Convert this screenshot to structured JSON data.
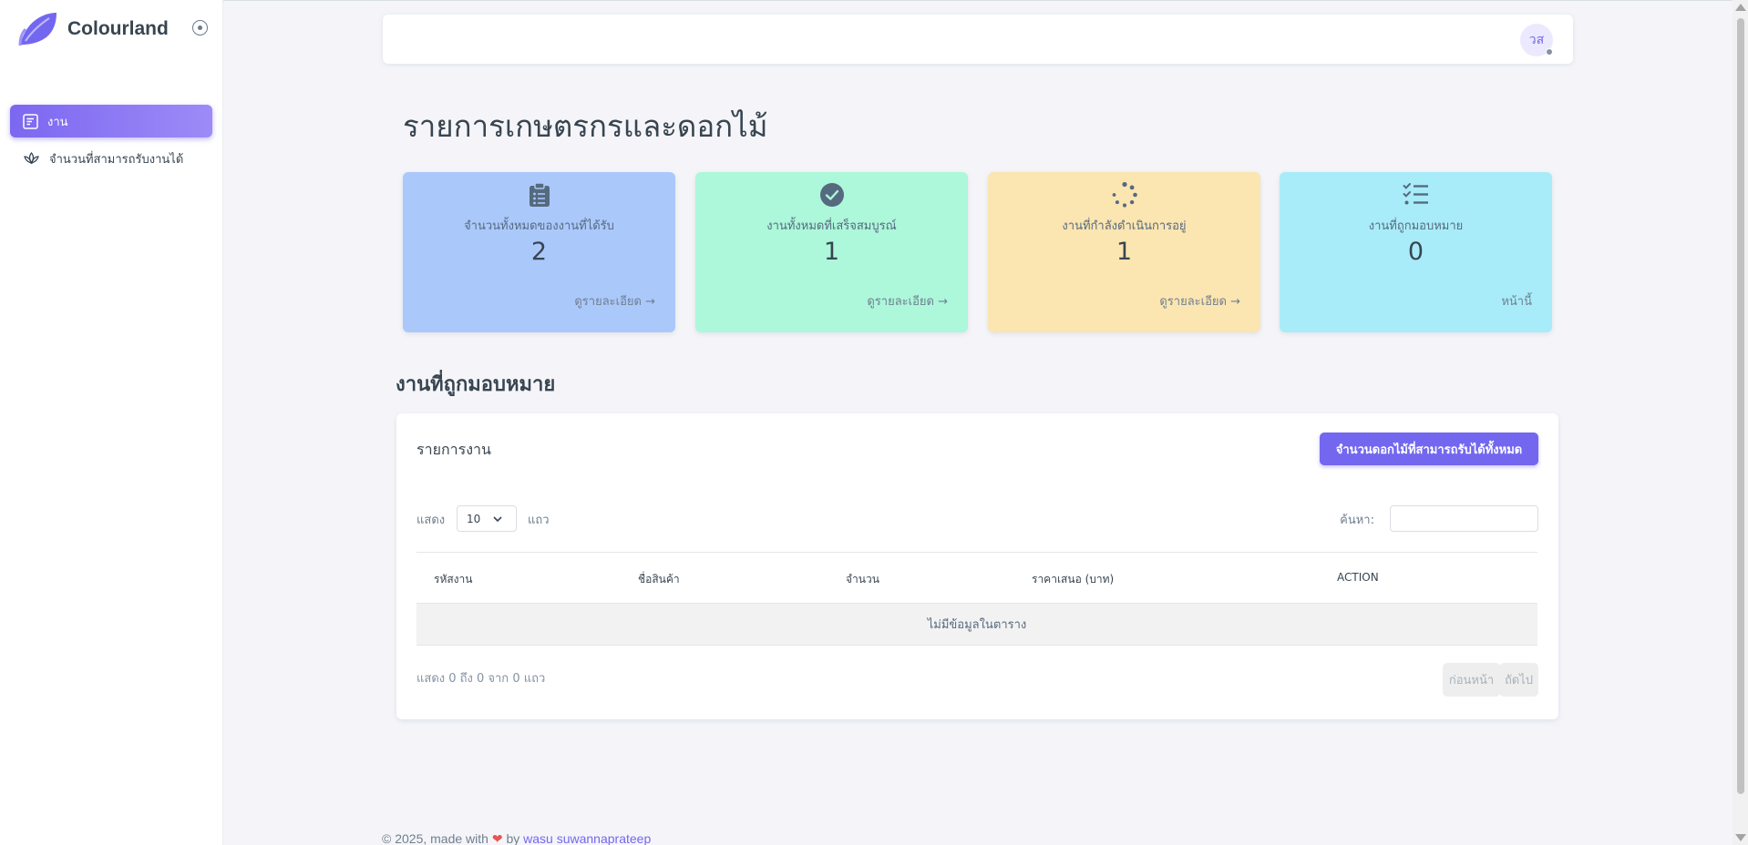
{
  "app": {
    "name": "Colourland"
  },
  "sidebar": {
    "items": [
      {
        "label": "งาน",
        "icon": "task-list-icon",
        "active": true
      },
      {
        "label": "จำนวนที่สามารถรับงานได้",
        "icon": "lotus-icon",
        "active": false
      }
    ]
  },
  "navbar": {
    "avatar_initials": "วส",
    "status": "offline"
  },
  "page": {
    "title": "รายการเกษตรกรและดอกไม้"
  },
  "cards": [
    {
      "icon": "clipboard-list-icon",
      "label": "จำนวนทั้งหมดของงานที่ได้รับ",
      "value": "2",
      "link": "ดูรายละเอียด →",
      "bg": "#abc8fb"
    },
    {
      "icon": "check-circle-icon",
      "label": "งานทั้งหมดที่เสร็จสมบูรณ์",
      "value": "1",
      "link": "ดูรายละเอียด →",
      "bg": "#adf7da"
    },
    {
      "icon": "loader-icon",
      "label": "งานที่กำลังดำเนินการอยู่",
      "value": "1",
      "link": "ดูรายละเอียด →",
      "bg": "#fbe5b1"
    },
    {
      "icon": "checklist-icon",
      "label": "งานที่ถูกมอบหมาย",
      "value": "0",
      "link": "หน้านี้",
      "bg": "#a9ecf9"
    }
  ],
  "section": {
    "title": "งานที่ถูกมอบหมาย"
  },
  "table_card": {
    "title": "รายการงาน",
    "button": "จำนวนดอกไม้ที่สามารถรับได้ทั้งหมด",
    "length_prefix": "แสดง",
    "length_value": "10",
    "length_suffix": "แถว",
    "search_label": "ค้นหา:",
    "search_value": "",
    "columns": [
      "รหัสงาน",
      "ชื่อสินค้า",
      "จำนวน",
      "ราคาเสนอ (บาท)",
      "ACTION"
    ],
    "empty_message": "ไม่มีข้อมูลในตาราง",
    "info": "แสดง 0 ถึง 0 จาก 0 แถว",
    "prev": "ก่อนหน้า",
    "next": "ถัดไป"
  },
  "footer": {
    "prefix": "© 2025, made with",
    "by": "by",
    "author": "wasu suwannaprateep"
  },
  "colors": {
    "primary": "#7367f0",
    "heading": "#384551"
  }
}
